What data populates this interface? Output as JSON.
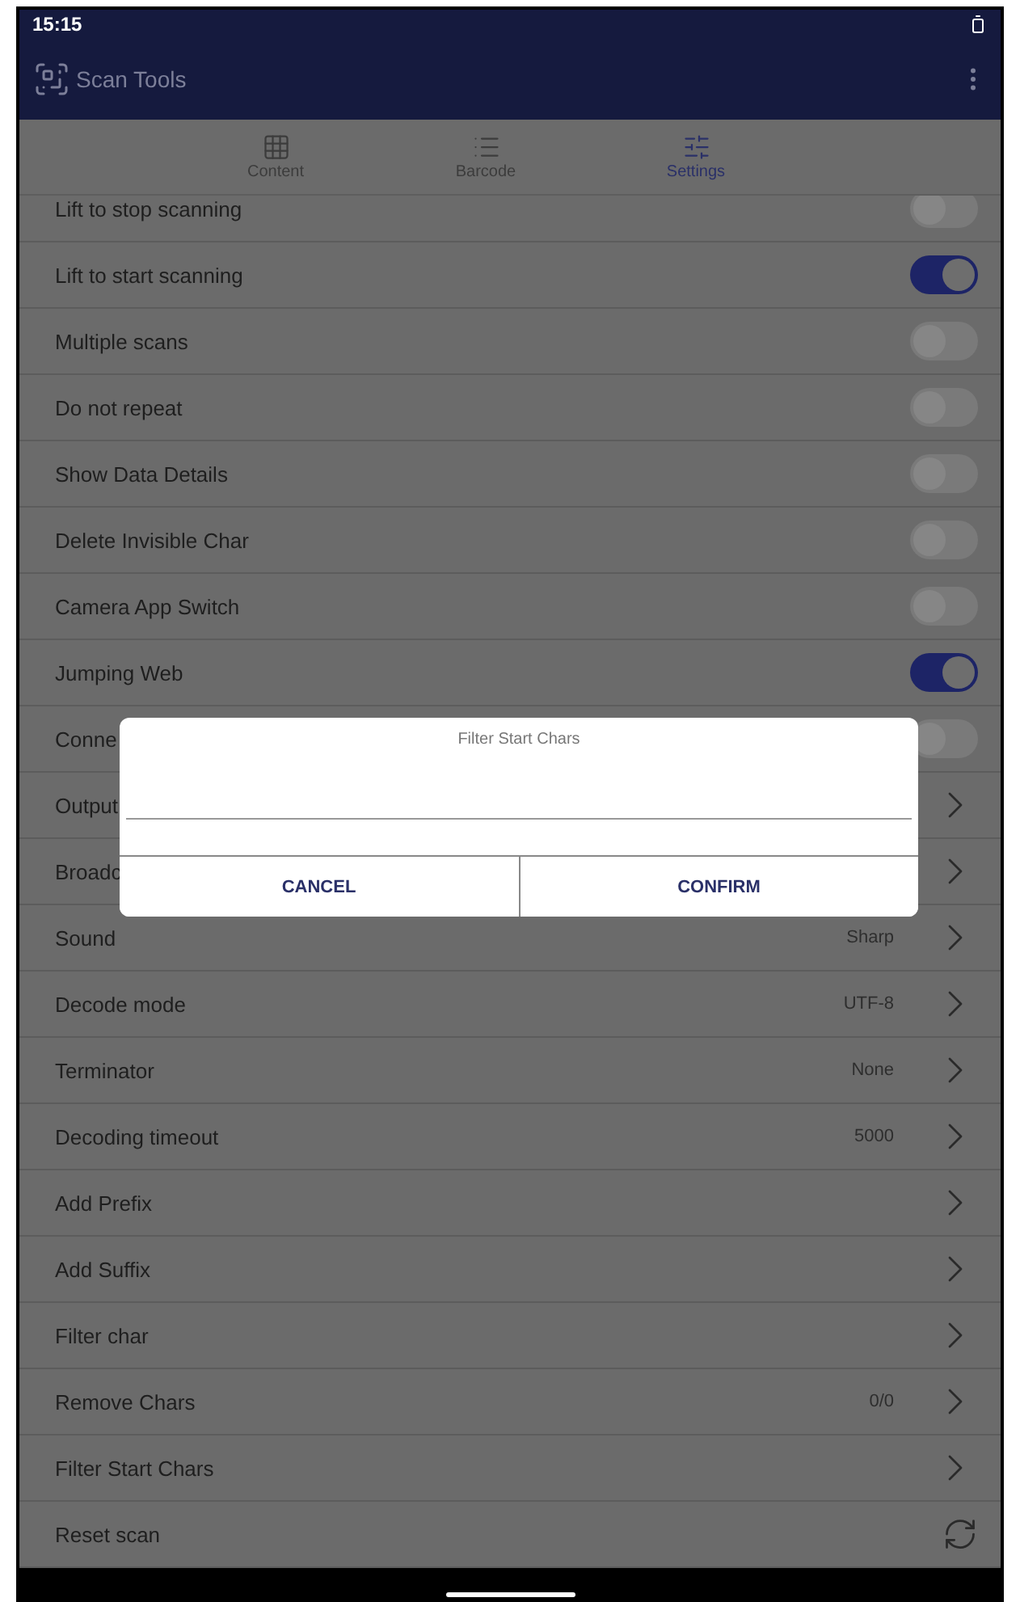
{
  "status_bar": {
    "time": "15:15"
  },
  "app_bar": {
    "title": "Scan Tools"
  },
  "tabs": [
    {
      "label": "Content",
      "selected": false
    },
    {
      "label": "Barcode",
      "selected": false
    },
    {
      "label": "Settings",
      "selected": true
    }
  ],
  "rows": [
    {
      "kind": "toggle",
      "label": "Lift to stop scanning",
      "on": false
    },
    {
      "kind": "toggle",
      "label": "Lift to start scanning",
      "on": true
    },
    {
      "kind": "toggle",
      "label": "Multiple scans",
      "on": false
    },
    {
      "kind": "toggle",
      "label": "Do not repeat",
      "on": false
    },
    {
      "kind": "toggle",
      "label": "Show Data Details",
      "on": false
    },
    {
      "kind": "toggle",
      "label": "Delete Invisible Char",
      "on": false
    },
    {
      "kind": "toggle",
      "label": "Camera App Switch",
      "on": false
    },
    {
      "kind": "toggle",
      "label": "Jumping Web",
      "on": true
    },
    {
      "kind": "toggle",
      "label": "Conne",
      "on": false
    },
    {
      "kind": "link",
      "label": "Output"
    },
    {
      "kind": "link",
      "label": "Broadc"
    },
    {
      "kind": "link",
      "label": "Sound",
      "value": "Sharp"
    },
    {
      "kind": "link",
      "label": "Decode mode",
      "value": "UTF-8"
    },
    {
      "kind": "link",
      "label": "Terminator",
      "value": "None"
    },
    {
      "kind": "link",
      "label": "Decoding timeout",
      "value": "5000"
    },
    {
      "kind": "link",
      "label": "Add Prefix"
    },
    {
      "kind": "link",
      "label": "Add Suffix"
    },
    {
      "kind": "link",
      "label": "Filter char"
    },
    {
      "kind": "link",
      "label": "Remove Chars",
      "value": "0/0"
    },
    {
      "kind": "link",
      "label": "Filter Start Chars"
    },
    {
      "kind": "reset",
      "label": "Reset scan"
    }
  ],
  "dialog": {
    "title": "Filter Start Chars",
    "buttons": [
      "CANCEL",
      "CONFIRM"
    ]
  }
}
